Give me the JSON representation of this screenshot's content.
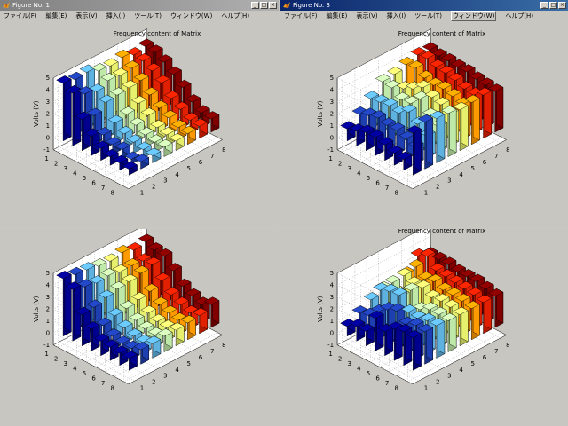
{
  "windows": [
    {
      "id": "fig1",
      "title": "Figure No. 1",
      "active": false,
      "show_menu": true,
      "plot_title": "Frequency content of Matrix",
      "grid": [
        [
          4.8,
          4.6,
          4.7,
          4.3,
          4.2,
          4.4,
          4.1,
          4.3
        ],
        [
          4.4,
          3.8,
          3.5,
          3.9,
          3.8,
          3.9,
          4.0,
          4.2
        ],
        [
          2.6,
          2.4,
          3.0,
          3.1,
          3.2,
          3.3,
          3.6,
          3.8
        ],
        [
          1.6,
          1.2,
          1.7,
          1.9,
          2.3,
          2.5,
          3.0,
          3.2
        ],
        [
          1.0,
          0.8,
          1.2,
          1.4,
          1.7,
          1.8,
          2.1,
          2.5
        ],
        [
          0.7,
          0.8,
          0.9,
          1.0,
          1.1,
          1.4,
          1.6,
          1.7
        ],
        [
          0.6,
          0.4,
          0.7,
          0.8,
          0.9,
          1.0,
          1.1,
          1.2
        ],
        [
          0.5,
          0.6,
          0.6,
          0.8,
          0.8,
          0.9,
          1.0,
          1.1
        ]
      ]
    },
    {
      "id": "fig3",
      "title": "Figure No. 3",
      "active": true,
      "show_menu": true,
      "plot_title": "Frequency content of Matrix",
      "grid": [
        [
          1.0,
          1.7,
          2.5,
          3.4,
          3.5,
          3.8,
          4.1,
          4.0
        ],
        [
          1.2,
          2.0,
          2.6,
          3.3,
          2.7,
          3.9,
          4.2,
          3.9
        ],
        [
          1.5,
          2.2,
          2.7,
          2.7,
          3.1,
          3.5,
          3.9,
          3.9
        ],
        [
          1.5,
          2.0,
          2.5,
          2.8,
          3.6,
          3.3,
          3.8,
          3.8
        ],
        [
          1.3,
          2.0,
          3.0,
          3.6,
          3.2,
          3.4,
          3.6,
          3.8
        ],
        [
          1.0,
          1.7,
          2.4,
          2.6,
          3.0,
          3.2,
          3.3,
          3.6
        ],
        [
          0.9,
          1.4,
          1.8,
          2.1,
          2.6,
          2.9,
          3.2,
          3.5
        ],
        [
          3.5,
          3.9,
          3.7,
          3.6,
          3.4,
          3.5,
          3.6,
          3.4
        ]
      ]
    },
    {
      "id": "fig2",
      "title": "",
      "active": false,
      "show_menu": false,
      "plot_title": "",
      "grid": [
        [
          4.8,
          4.6,
          4.5,
          4.3,
          4.2,
          4.4,
          4.1,
          4.3
        ],
        [
          4.3,
          4.0,
          3.8,
          3.9,
          3.7,
          3.7,
          3.6,
          4.0
        ],
        [
          2.6,
          2.7,
          3.0,
          3.2,
          3.3,
          3.5,
          3.7,
          3.9
        ],
        [
          1.8,
          1.6,
          1.9,
          2.0,
          2.2,
          2.4,
          2.8,
          3.1
        ],
        [
          1.2,
          1.1,
          1.3,
          1.4,
          1.5,
          1.7,
          2.0,
          2.2
        ],
        [
          1.1,
          0.9,
          1.0,
          1.1,
          1.2,
          1.4,
          1.6,
          1.8
        ],
        [
          1.0,
          0.9,
          0.9,
          1.0,
          1.1,
          1.2,
          1.3,
          1.5
        ],
        [
          1.0,
          1.2,
          1.2,
          1.3,
          1.3,
          1.4,
          1.5,
          1.9
        ]
      ]
    },
    {
      "id": "fig4",
      "title": "",
      "active": false,
      "show_menu": false,
      "plot_title": "Frequency content of Matrix",
      "grid": [
        [
          0.8,
          1.4,
          2.0,
          2.4,
          1.7,
          2.6,
          3.6,
          3.2
        ],
        [
          1.2,
          1.6,
          3.2,
          3.3,
          3.4,
          3.6,
          4.0,
          3.2
        ],
        [
          1.2,
          2.3,
          3.5,
          2.6,
          3.1,
          3.0,
          3.2,
          3.2
        ],
        [
          2.7,
          2.9,
          3.6,
          3.5,
          3.2,
          3.2,
          3.1,
          3.0
        ],
        [
          2.0,
          3.2,
          2.6,
          2.3,
          2.8,
          2.9,
          3.0,
          3.0
        ],
        [
          2.6,
          2.5,
          2.5,
          2.7,
          2.9,
          2.9,
          2.9,
          3.0
        ],
        [
          2.8,
          2.8,
          2.7,
          2.7,
          2.8,
          2.8,
          2.8,
          2.8
        ],
        [
          2.7,
          2.7,
          2.7,
          2.6,
          2.6,
          2.6,
          2.6,
          2.6
        ]
      ]
    }
  ],
  "menu": [
    {
      "label": "ファイル(F)"
    },
    {
      "label": "編集(E)"
    },
    {
      "label": "表示(V)"
    },
    {
      "label": "挿入(I)"
    },
    {
      "label": "ツール(T)"
    },
    {
      "label": "ウィンドウ(W)"
    },
    {
      "label": "ヘルプ(H)"
    }
  ],
  "menu_highlight_index": 5,
  "axes": {
    "y_label": "Volts (V)",
    "y_ticks": [
      "-1",
      "0",
      "1",
      "2",
      "3",
      "4",
      "5"
    ],
    "y_min": -1,
    "y_max": 5,
    "x_ticks": [
      "1",
      "2",
      "3",
      "4",
      "5",
      "6",
      "7",
      "8"
    ],
    "z_ticks": [
      "1",
      "2",
      "3",
      "4",
      "5",
      "6",
      "7",
      "8"
    ]
  },
  "colors": {
    "colormap": [
      "#00008f",
      "#0000c8",
      "#1e3fb0",
      "#3a78c8",
      "#5fb1e0",
      "#8fd4c8",
      "#bfe9a8",
      "#e6f06c",
      "#ffd000",
      "#ff9a00",
      "#ff5a00",
      "#e02000",
      "#a80000",
      "#800000"
    ],
    "active_title": "#0a246a",
    "inactive_title": "#808080"
  },
  "icons": {
    "window_icon": "matlab-logo-icon",
    "min": "minimize-icon",
    "max": "maximize-icon",
    "close": "close-icon"
  }
}
